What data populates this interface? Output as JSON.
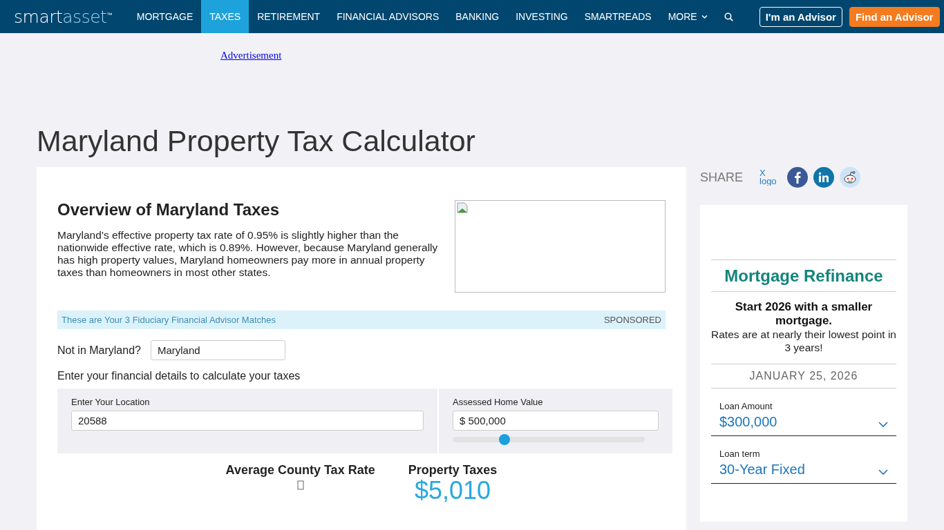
{
  "nav": {
    "logo": {
      "main": "smart",
      "accent": "asset",
      "mark": "™"
    },
    "items": [
      {
        "label": "MORTGAGE",
        "selected": false
      },
      {
        "label": "TAXES",
        "selected": true
      },
      {
        "label": "RETIREMENT",
        "selected": false
      },
      {
        "label": "FINANCIAL ADVISORS",
        "selected": false
      },
      {
        "label": "BANKING",
        "selected": false
      },
      {
        "label": "INVESTING",
        "selected": false
      },
      {
        "label": "SMARTREADS",
        "selected": false
      },
      {
        "label": "MORE",
        "selected": false
      }
    ],
    "buttons": [
      {
        "label": "I'm an Advisor",
        "kind": "outline"
      },
      {
        "label": "Find an Advisor",
        "kind": "filled"
      }
    ]
  },
  "ad": {
    "label": "Advertisement"
  },
  "title": "Maryland Property Tax Calculator",
  "overview": {
    "heading": "Overview of Maryland Taxes",
    "text": "Maryland’s effective property tax rate of 0.95% is slightly higher than the nationwide effective rate, which is 0.89%. However, because Maryland generally has high property values, Maryland homeowners pay more in annual property taxes than homeowners in most other states."
  },
  "sponsored": {
    "text": "These are Your 3 Fiduciary Financial Advisor Matches",
    "tag": "SPONSORED"
  },
  "state_picker": {
    "label": "Not in Maryland?",
    "value": "Maryland"
  },
  "calculator": {
    "intro": "Enter your financial details to calculate your taxes",
    "location": {
      "label": "Enter Your Location",
      "value": "20588"
    },
    "home_value": {
      "label": "Assessed Home Value",
      "value": "$ 500,000",
      "level": 0.27
    },
    "results": [
      {
        "label": "Average County Tax Rate",
        "kind": "icon"
      },
      {
        "label": "Property Taxes",
        "value": "$5,010",
        "kind": "value"
      }
    ]
  },
  "share": {
    "label": "SHARE",
    "items": [
      {
        "kind": "x",
        "alt": "X logo"
      },
      {
        "kind": "facebook"
      },
      {
        "kind": "linkedin"
      },
      {
        "kind": "reddit"
      }
    ]
  },
  "widget": {
    "title": "Mortgage Refinance",
    "headline": "Start 2026 with a smaller mortgage.",
    "subtext": "Rates are at nearly their lowest point in 3 years!",
    "date": "JANUARY 25, 2026",
    "fields": [
      {
        "label": "Loan Amount",
        "value": "$300,000"
      },
      {
        "label": "Loan term",
        "value": "30-Year Fixed"
      }
    ]
  }
}
